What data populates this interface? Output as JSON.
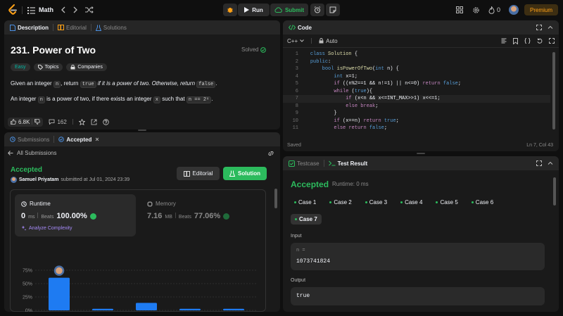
{
  "nav": {
    "problem_list_label": "Math",
    "run_label": "Run",
    "submit_label": "Submit",
    "streak_count": "0",
    "premium_label": "Premium"
  },
  "left_top": {
    "tabs": [
      "Description",
      "Editorial",
      "Solutions"
    ],
    "title": "231. Power of Two",
    "status": "Solved",
    "tags": [
      "Easy",
      "Topics",
      "Companies"
    ],
    "p1": {
      "a": "Given an integer ",
      "b": "n",
      "c": ", return ",
      "d": "true",
      "e": " if it is a power of two. Otherwise, return ",
      "f": "false",
      "g": "."
    },
    "p2": {
      "a": "An integer ",
      "b": "n",
      "c": " is a power of two, if there exists an integer ",
      "d": "x",
      "e": " such that ",
      "f": "n == 2ˣ",
      "g": "."
    },
    "likes": "6.8K",
    "comments": "162"
  },
  "left_bottom": {
    "tabs": [
      "Submissions",
      "Accepted"
    ],
    "back_label": "All Submissions",
    "result": "Accepted",
    "user": "Samuel Priyatam",
    "submitted": "submitted at Jul 01, 2024 23:39",
    "editorial_btn": "Editorial",
    "solution_btn": "Solution",
    "runtime": {
      "label": "Runtime",
      "value": "0",
      "unit": "ms",
      "beats_label": "Beats",
      "beats_value": "100.00%",
      "analyze": "Analyze Complexity"
    },
    "memory": {
      "label": "Memory",
      "value": "7.16",
      "unit": "MB",
      "beats_label": "Beats",
      "beats_value": "77.06%"
    }
  },
  "chart_data": {
    "type": "bar",
    "y_ticks": [
      "75%",
      "50%",
      "25%",
      "0%"
    ],
    "ylim": [
      0,
      75
    ],
    "values": [
      61,
      3,
      14,
      3,
      3
    ],
    "highlight_index": 0,
    "bar_color": "#1e7bf2"
  },
  "code_panel": {
    "title": "Code",
    "language": "C++",
    "mode": "Auto",
    "status": "Saved",
    "cursor": "Ln 7, Col 43",
    "lines": [
      "class Solution {",
      "public:",
      "    bool isPowerOfTwo(int n) {",
      "        int x=1;",
      "        if ((n%2==1 && n!=1) || n<=0) return false;",
      "        while (true){",
      "            if (x<n && x<=INT_MAX>>1) x<<=1;",
      "            else break;",
      "        }",
      "        if (x==n) return true;",
      "        else return false;"
    ],
    "line_numbers": [
      "1",
      "2",
      "3",
      "4",
      "5",
      "6",
      "7",
      "8",
      "9",
      "10",
      "11"
    ]
  },
  "result_panel": {
    "tabs": [
      "Testcase",
      "Test Result"
    ],
    "status": "Accepted",
    "runtime": "Runtime: 0 ms",
    "cases": [
      "Case 1",
      "Case 2",
      "Case 3",
      "Case 4",
      "Case 5",
      "Case 6"
    ],
    "active_case": "Case 7",
    "input_label": "Input",
    "input_var": "n =",
    "input_value": "1073741824",
    "output_label": "Output",
    "output_value": "true"
  },
  "colors": {
    "accent_green": "#2cbb5d",
    "premium": "#ffa116",
    "easy": "#00b8a3",
    "bar": "#1e7bf2"
  }
}
